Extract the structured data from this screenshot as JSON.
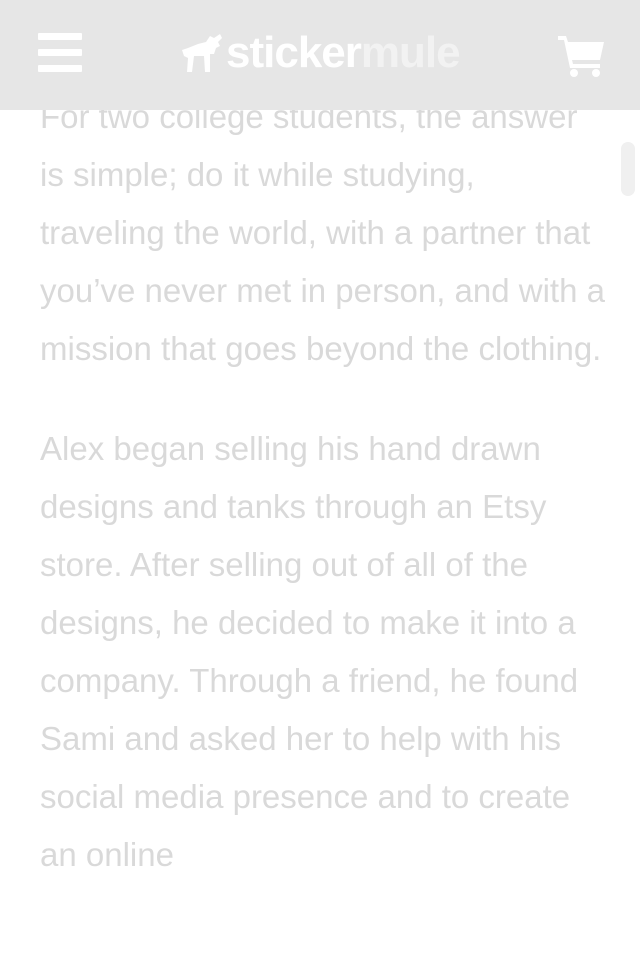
{
  "header": {
    "menu_icon": "hamburger-menu-icon",
    "logo": {
      "part1": "sticker",
      "part2": "mule",
      "icon": "mule-icon"
    },
    "cart_icon": "shopping-cart-icon"
  },
  "article": {
    "paragraphs": [
      "For two college students, the answer is simple; do it while studying, traveling the world, with a partner that you’ve never met in person, and with a mission that goes beyond the clothing.",
      "Alex began selling his hand drawn designs and tanks through an Etsy store. After selling out of all of the designs, he decided to make it into a company. Through a friend, he found Sami and asked her to help with his social media presence and to create an online"
    ]
  },
  "colors": {
    "header_bg": "#e6e6e6",
    "text": "#d9d9d9",
    "icon": "#ffffff"
  }
}
